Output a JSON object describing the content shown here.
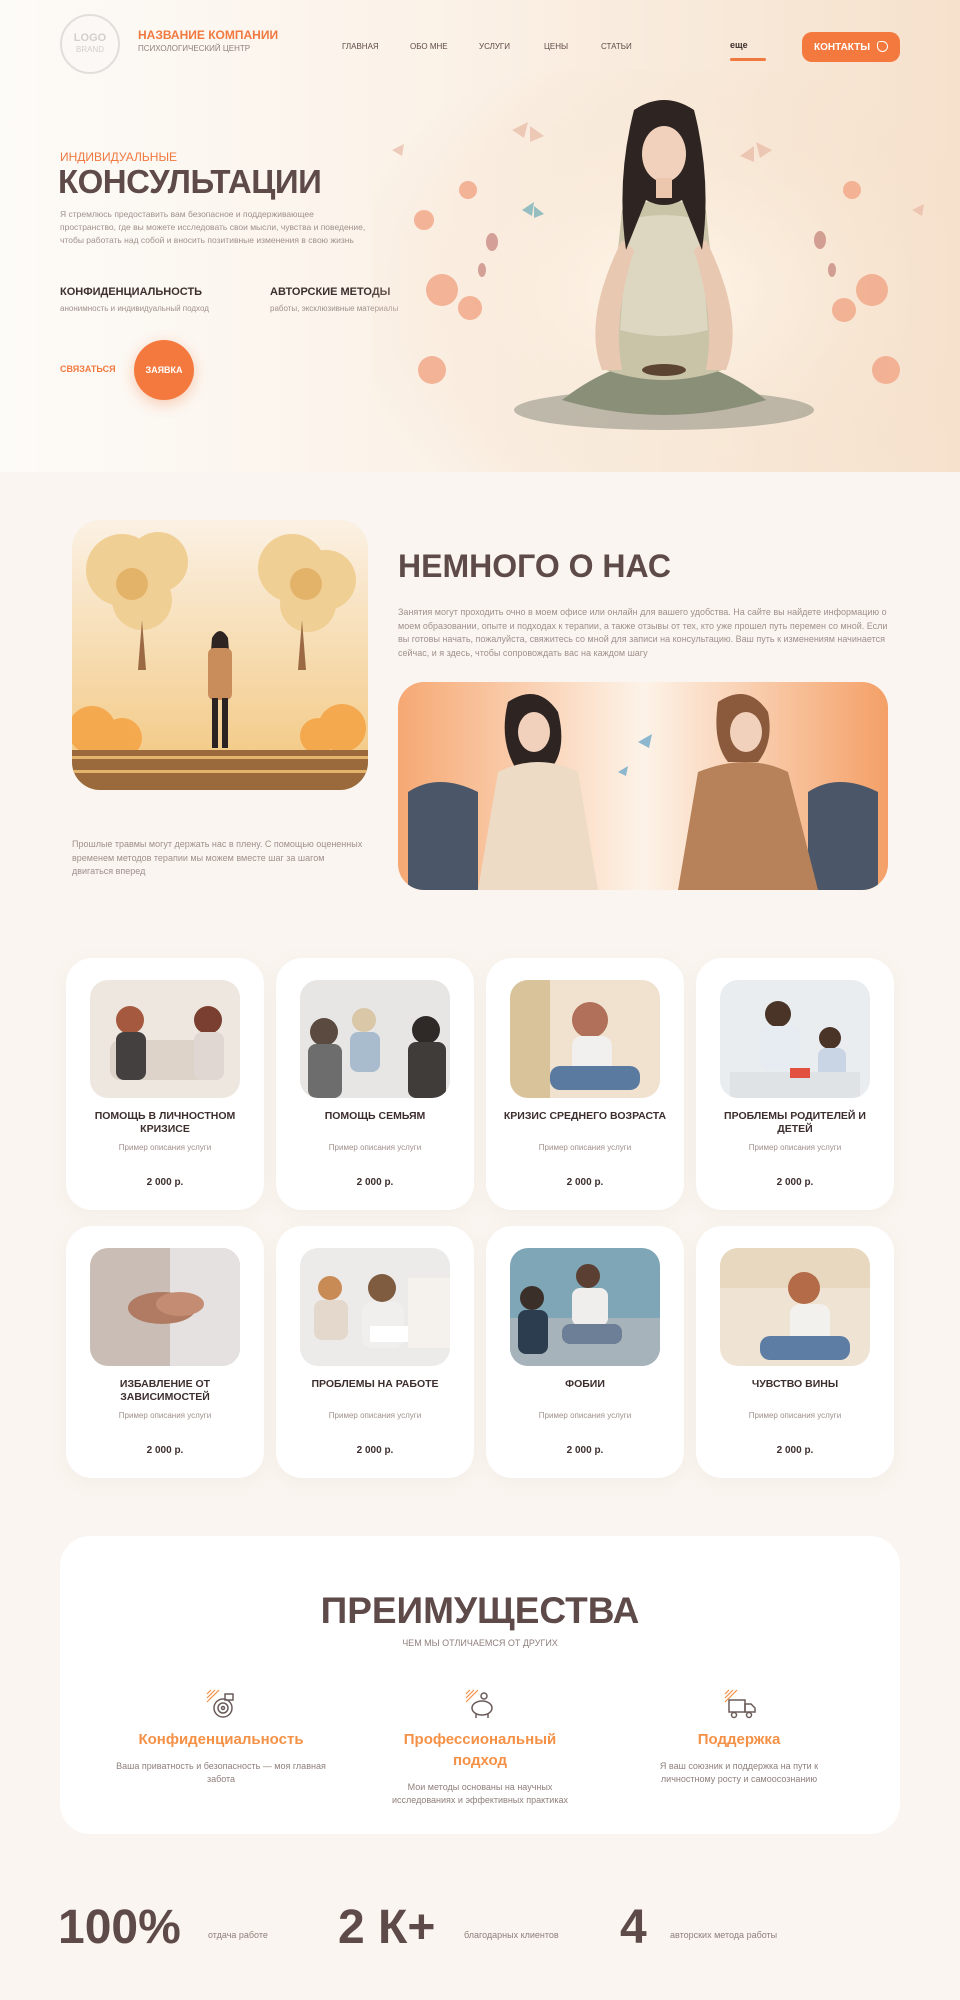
{
  "header": {
    "logo_text": "LOGO",
    "logo_sub": "BRAND",
    "company_name": "Название компании",
    "company_sub": "Психологический центр",
    "nav": [
      "Главная",
      "Обо мне",
      "Услуги",
      "Цены",
      "Статьи"
    ],
    "more": "еще",
    "contact_button": "Контакты"
  },
  "hero": {
    "kicker": "Индивидуальные",
    "title": "Консультации",
    "description": "Я стремлюсь предоставить вам безопасное и поддерживающее пространство, где вы можете исследовать свои мысли, чувства и поведение, чтобы работать над собой и вносить позитивные изменения в свою жизнь",
    "features": [
      {
        "title": "Конфиденциальность",
        "desc": "анонимность и индивидуальный подход"
      },
      {
        "title": "Авторские методы",
        "desc": "работы, эксклюзивные материалы"
      }
    ],
    "link_label": "Связаться",
    "cta_label": "Заявка"
  },
  "about": {
    "title": "Немного о нас",
    "text": "Занятия могут проходить очно в моем офисе или онлайн для вашего удобства. На сайте вы найдете информацию о моем образовании, опыте и подходах к терапии, а также отзывы от тех, кто уже прошел путь перемен со мной. Если вы готовы начать, пожалуйста, свяжитесь со мной для записи на консультацию. Ваш путь к изменениям начинается сейчас, и я здесь, чтобы сопровождать вас на каждом шагу",
    "caption": "Прошлые травмы могут держать нас в плену. С помощью оцененных временем методов терапии мы можем вместе шаг за шагом двигаться вперед"
  },
  "services": [
    {
      "title": "Помощь в личностном кризисе",
      "desc": "Пример описания услуги",
      "price": "2 000 р."
    },
    {
      "title": "Помощь семьям",
      "desc": "Пример описания услуги",
      "price": "2 000 р."
    },
    {
      "title": "Кризис среднего возраста",
      "desc": "Пример описания услуги",
      "price": "2 000 р."
    },
    {
      "title": "Проблемы родителей и детей",
      "desc": "Пример описания услуги",
      "price": "2 000 р."
    },
    {
      "title": "Избавление от зависимостей",
      "desc": "Пример описания услуги",
      "price": "2 000 р."
    },
    {
      "title": "Проблемы на работе",
      "desc": "Пример описания услуги",
      "price": "2 000 р."
    },
    {
      "title": "Фобии",
      "desc": "Пример описания услуги",
      "price": "2 000 р."
    },
    {
      "title": "Чувство вины",
      "desc": "Пример описания услуги",
      "price": "2 000 р."
    }
  ],
  "advantages": {
    "title": "Преимущества",
    "subtitle": "Чем мы отличаемся от других",
    "items": [
      {
        "title": "Конфиденциальность",
        "desc": "Ваша приватность и безопасность — моя главная забота",
        "icon": "target-icon"
      },
      {
        "title": "Профессиональный подход",
        "desc": "Мои методы основаны на научных исследованиях и эффективных практиках",
        "icon": "piggy-bank-icon"
      },
      {
        "title": "Поддержка",
        "desc": "Я ваш союзник и поддержка на пути к личностному росту и самоосознанию",
        "icon": "truck-icon"
      }
    ]
  },
  "stats": [
    {
      "value": "100%",
      "label": "отдача работе"
    },
    {
      "value": "2 К+",
      "label": "благодарных клиентов"
    },
    {
      "value": "4",
      "label": "авторских метода работы"
    }
  ],
  "colors": {
    "accent": "#f4793e",
    "text": "#5e4a48",
    "background": "#faf5f0"
  }
}
